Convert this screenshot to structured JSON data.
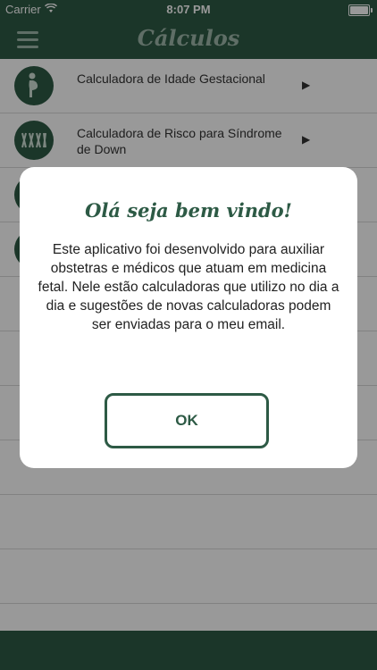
{
  "status_bar": {
    "carrier": "Carrier",
    "time": "8:07 PM",
    "wifi_icon": "wifi-icon",
    "battery_icon": "battery-icon",
    "battery_level": 1.0
  },
  "nav": {
    "title": "Cálculos",
    "menu_icon": "hamburger-menu-icon"
  },
  "list": {
    "items": [
      {
        "label": "Calculadora de Idade Gestacional",
        "icon": "pregnant-woman-icon"
      },
      {
        "label": "Calculadora de Risco para Síndrome de Down",
        "icon": "chromosomes-icon"
      },
      {
        "label": "",
        "icon": ""
      },
      {
        "label": "",
        "icon": ""
      },
      {
        "label": "",
        "icon": ""
      },
      {
        "label": "",
        "icon": ""
      },
      {
        "label": "",
        "icon": ""
      },
      {
        "label": "",
        "icon": ""
      },
      {
        "label": "",
        "icon": ""
      },
      {
        "label": "",
        "icon": ""
      }
    ]
  },
  "modal": {
    "title": "Olá seja bem vindo!",
    "body": "Este aplicativo foi desenvolvido para auxiliar obstetras e médicos que atuam em medicina fetal. Nele estão calculadoras que utilizo no dia a dia e sugestões de novas calculadoras podem ser enviadas para o meu email.",
    "ok_label": "OK"
  },
  "colors": {
    "brand": "#2d5a45",
    "nav_text": "#9fb8aa",
    "overlay": "rgba(0,0,0,0.4)"
  }
}
